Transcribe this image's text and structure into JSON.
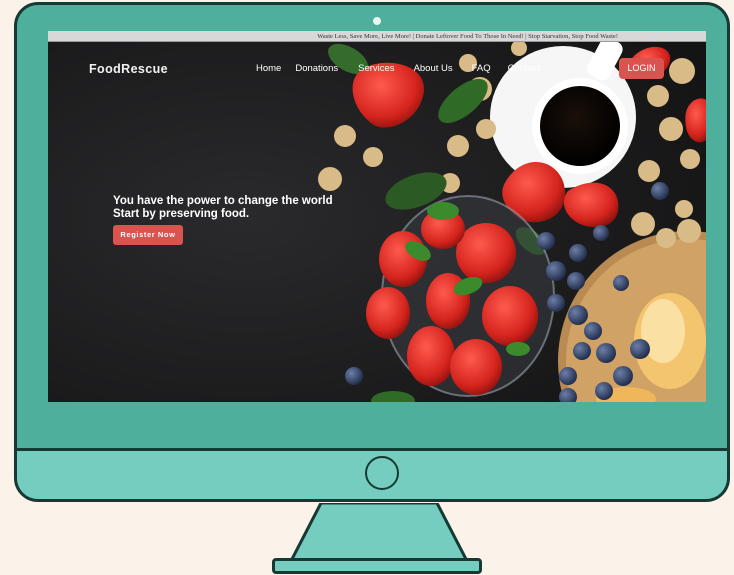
{
  "ticker": {
    "text": "Waste Less, Save More, Live More!  |  Donate Leftover Food To Those In Need!  |  Stop Starvation, Stop Food Waste!"
  },
  "header": {
    "brand": "FoodRescue",
    "nav": [
      {
        "label": "Home"
      },
      {
        "label": "Donations"
      },
      {
        "label": "Services"
      },
      {
        "label": "About Us"
      },
      {
        "label": "FAQ"
      },
      {
        "label": "Contact"
      }
    ],
    "login_label": "LOGIN"
  },
  "hero": {
    "line1": "You have the power to change the world",
    "line2": "Start by preserving food.",
    "cta_label": "Register Now"
  },
  "colors": {
    "monitor_frame": "#4daf9c",
    "monitor_chin": "#74cdbe",
    "outline": "#163a33",
    "page_background": "#fbf3e9",
    "accent_button": "#d9534f"
  }
}
